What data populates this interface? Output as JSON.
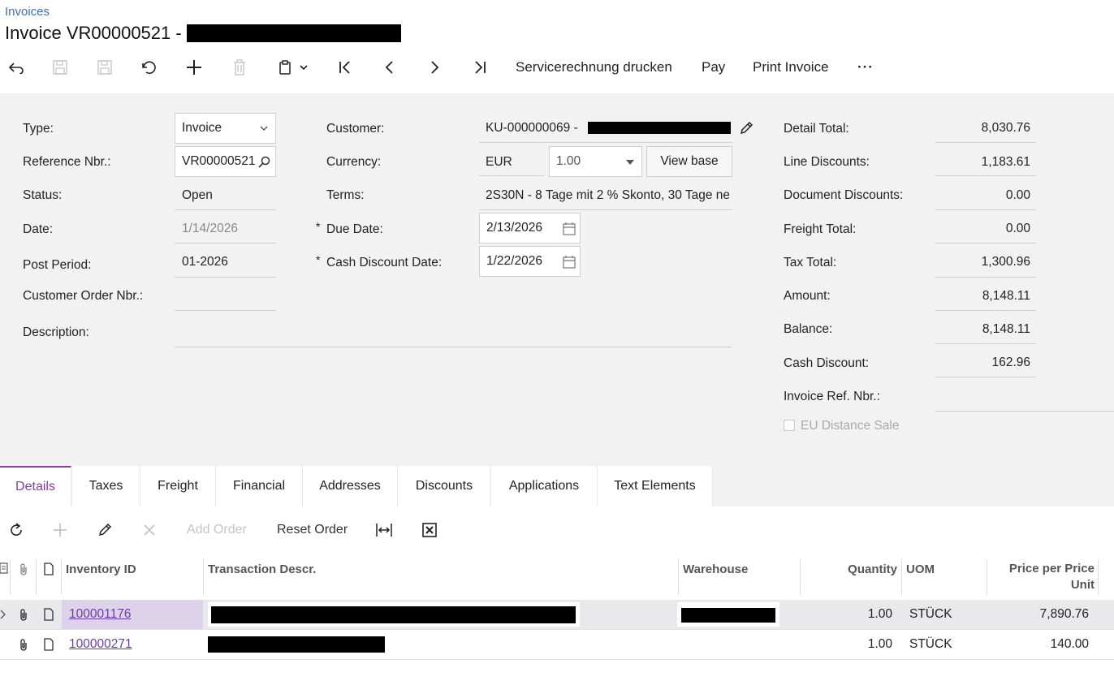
{
  "breadcrumb": "Invoices",
  "page_title": "Invoice VR00000521 -",
  "toolbar": {
    "servicerechnung": "Servicerechnung drucken",
    "pay": "Pay",
    "print_invoice": "Print Invoice",
    "more": "···"
  },
  "form": {
    "type_label": "Type:",
    "type_value": "Invoice",
    "ref_label": "Reference Nbr.:",
    "ref_value": "VR00000521",
    "status_label": "Status:",
    "status_value": "Open",
    "date_label": "Date:",
    "date_value": "1/14/2026",
    "post_period_label": "Post Period:",
    "post_period_value": "01-2026",
    "cust_order_label": "Customer Order Nbr.:",
    "description_label": "Description:",
    "customer_label": "Customer:",
    "customer_value": "KU-000000069 -",
    "currency_label": "Currency:",
    "currency_value": "EUR",
    "rate_value": "1.00",
    "view_base": "View base",
    "terms_label": "Terms:",
    "terms_value": "2S30N - 8 Tage mit 2 % Skonto, 30 Tage ne",
    "required_mark": "*",
    "due_date_label": "Due Date:",
    "due_date_value": "2/13/2026",
    "cash_disc_date_label": "Cash Discount Date:",
    "cash_disc_date_value": "1/22/2026"
  },
  "totals": {
    "detail_total_label": "Detail Total:",
    "detail_total": "8,030.76",
    "line_disc_label": "Line Discounts:",
    "line_disc": "1,183.61",
    "doc_disc_label": "Document Discounts:",
    "doc_disc": "0.00",
    "freight_label": "Freight Total:",
    "freight": "0.00",
    "tax_label": "Tax Total:",
    "tax": "1,300.96",
    "amount_label": "Amount:",
    "amount": "8,148.11",
    "balance_label": "Balance:",
    "balance": "8,148.11",
    "cash_disc_label": "Cash Discount:",
    "cash_disc": "162.96",
    "inv_ref_label": "Invoice Ref. Nbr.:",
    "eu_distance": "EU Distance Sale"
  },
  "tabs": [
    "Details",
    "Taxes",
    "Freight",
    "Financial",
    "Addresses",
    "Discounts",
    "Applications",
    "Text Elements"
  ],
  "grid_toolbar": {
    "add_order": "Add Order",
    "reset_order": "Reset Order"
  },
  "grid": {
    "headers": {
      "inventory_id": "Inventory ID",
      "descr": "Transaction Descr.",
      "warehouse": "Warehouse",
      "quantity": "Quantity",
      "uom": "UOM",
      "price_1": "Price per Price",
      "price_2": "Unit"
    },
    "rows": [
      {
        "inventory_id": "100001176",
        "quantity": "1.00",
        "uom": "STÜCK",
        "price": "7,890.76"
      },
      {
        "inventory_id": "100000271",
        "quantity": "1.00",
        "uom": "STÜCK",
        "price": "140.00"
      }
    ]
  }
}
